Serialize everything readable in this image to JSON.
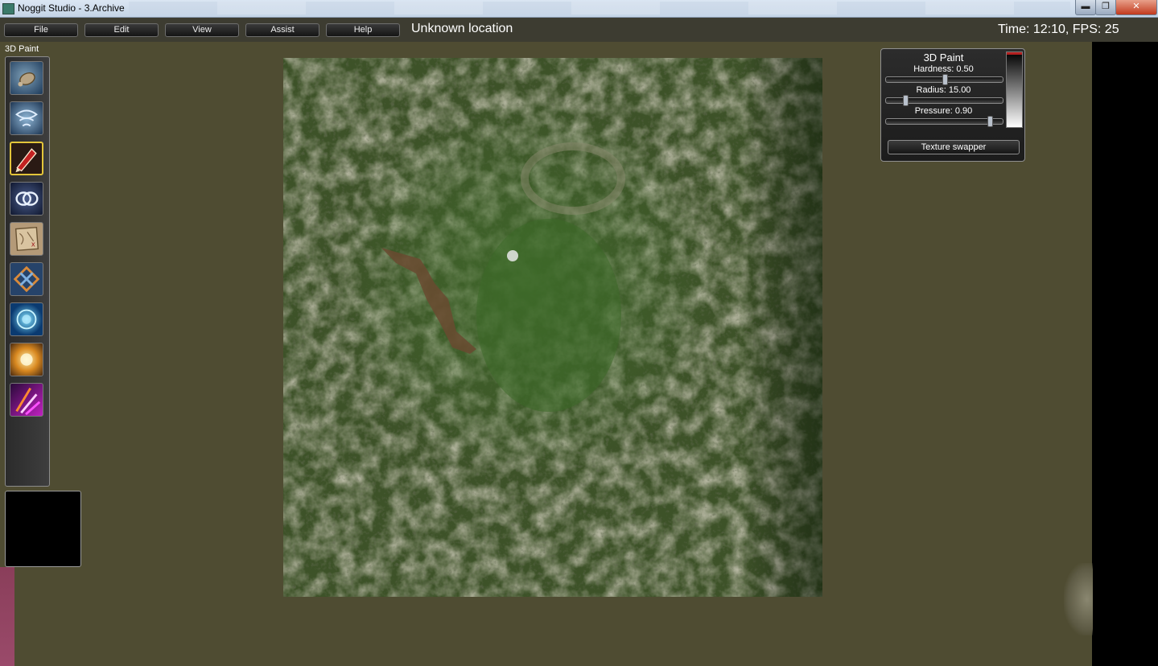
{
  "window": {
    "title": "Noggit Studio - 3.Archive",
    "min_glyph": "▬",
    "max_glyph": "❐",
    "close_glyph": "✕"
  },
  "menu": {
    "items": [
      "File",
      "Edit",
      "View",
      "Assist",
      "Help"
    ],
    "location": "Unknown location",
    "status": "Time: 12:10, FPS: 25"
  },
  "tool_panel": {
    "title": "3D Paint",
    "tools": [
      {
        "icon": "raise-lower-icon"
      },
      {
        "icon": "flatten-blur-icon"
      },
      {
        "icon": "texture-paint-icon",
        "active": true
      },
      {
        "icon": "holes-icon"
      },
      {
        "icon": "area-id-icon"
      },
      {
        "icon": "impassible-flag-icon"
      },
      {
        "icon": "water-icon"
      },
      {
        "icon": "object-editor-icon"
      },
      {
        "icon": "mccv-paint-icon"
      }
    ]
  },
  "brush": {
    "title": "3D Paint",
    "hardness_label": "Hardness: 0.50",
    "radius_label": "Radius: 15.00",
    "pressure_label": "Pressure: 0.90",
    "hardness": 0.5,
    "radius_fraction": 0.15,
    "pressure": 0.9,
    "texture_swapper_label": "Texture swapper"
  },
  "colors": {
    "ground": "#4f4c32",
    "menubar": "#3d3c31",
    "active_tool_border": "#e3c53a",
    "terrain_green": "#3c4e28"
  }
}
